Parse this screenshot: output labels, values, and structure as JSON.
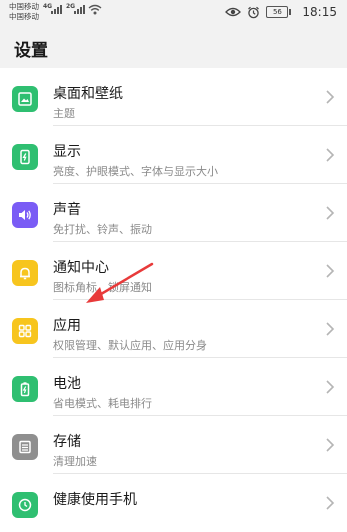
{
  "status_bar": {
    "carrier_1": "中国移动",
    "carrier_2": "中国移动",
    "net_1": "4G",
    "net_2": "2G",
    "battery": "56",
    "time": "18:15"
  },
  "page": {
    "title": "设置"
  },
  "items": [
    {
      "title": "桌面和壁纸",
      "subtitle": "主题",
      "icon": "wallpaper-icon",
      "color": "#2fbf71"
    },
    {
      "title": "显示",
      "subtitle": "亮度、护眼模式、字体与显示大小",
      "icon": "display-icon",
      "color": "#2fbf71"
    },
    {
      "title": "声音",
      "subtitle": "免打扰、铃声、振动",
      "icon": "sound-icon",
      "color": "#7a5cf5"
    },
    {
      "title": "通知中心",
      "subtitle": "图标角标、锁屏通知",
      "icon": "notification-bell-icon",
      "color": "#f7c51e"
    },
    {
      "title": "应用",
      "subtitle": "权限管理、默认应用、应用分身",
      "icon": "apps-grid-icon",
      "color": "#f7c51e"
    },
    {
      "title": "电池",
      "subtitle": "省电模式、耗电排行",
      "icon": "battery-icon",
      "color": "#2fbf71"
    },
    {
      "title": "存储",
      "subtitle": "清理加速",
      "icon": "storage-icon",
      "color": "#8f8f8f"
    },
    {
      "title": "健康使用手机",
      "subtitle": "",
      "icon": "health-usage-icon",
      "color": "#2fbf71"
    }
  ],
  "annotation": {
    "arrow_color": "#e83a3a"
  }
}
